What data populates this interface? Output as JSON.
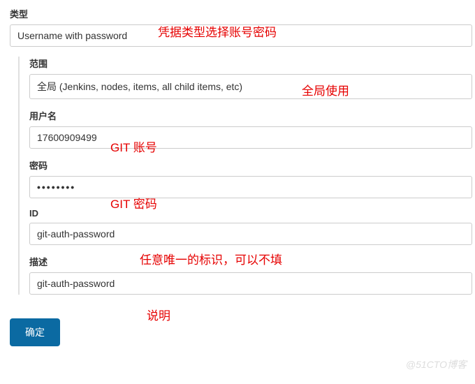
{
  "type": {
    "label": "类型",
    "value": "Username with password",
    "annotation": "凭据类型选择账号密码"
  },
  "scope": {
    "label": "范围",
    "value": "全局 (Jenkins, nodes, items, all child items, etc)",
    "annotation": "全局使用"
  },
  "username": {
    "label": "用户名",
    "value": "17600909499",
    "annotation": "GIT 账号"
  },
  "password": {
    "label": "密码",
    "value": "••••••••",
    "annotation": "GIT 密码"
  },
  "id": {
    "label": "ID",
    "value": "git-auth-password",
    "annotation": "任意唯一的标识，可以不填"
  },
  "description": {
    "label": "描述",
    "value": "git-auth-password",
    "annotation": "说明"
  },
  "submit": {
    "label": "确定"
  },
  "watermark": "@51CTO博客"
}
